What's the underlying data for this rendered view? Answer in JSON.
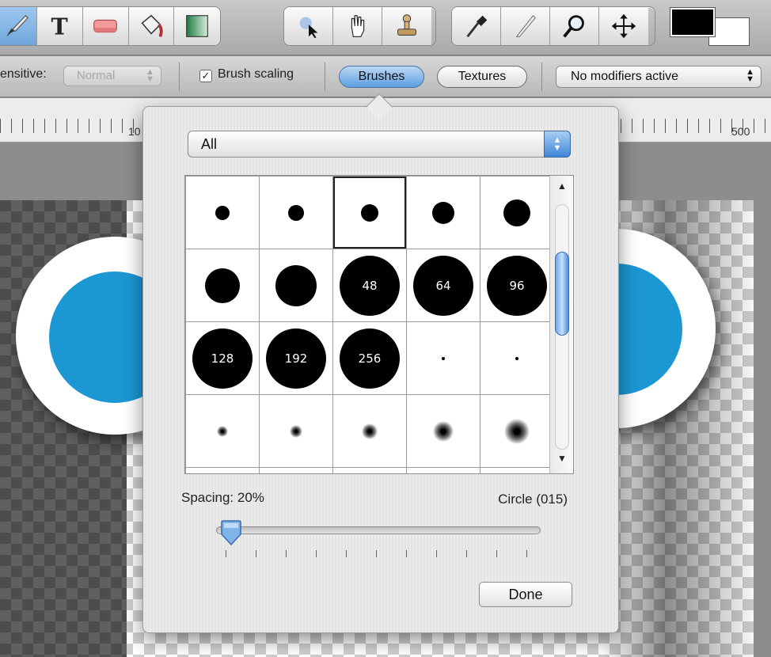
{
  "options_bar": {
    "mode_label": "ensitive:",
    "mode_value": "Normal",
    "brush_scaling_label": "Brush scaling",
    "brush_scaling_checked": true,
    "brushes_tab": "Brushes",
    "textures_tab": "Textures",
    "modifiers_value": "No modifiers active"
  },
  "ruler": {
    "labels": [
      "10",
      "500"
    ]
  },
  "brushes_panel": {
    "category": "All",
    "brushes": [
      {
        "size": 1,
        "label": ""
      },
      {
        "size": 2,
        "label": ""
      },
      {
        "size": 3,
        "label": "",
        "selected": true
      },
      {
        "size": 4,
        "label": ""
      },
      {
        "size": 5,
        "label": ""
      },
      {
        "size": 6,
        "label": ""
      },
      {
        "size": 7,
        "label": ""
      },
      {
        "size": 8,
        "label": "48"
      },
      {
        "size": 8,
        "label": "64"
      },
      {
        "size": 8,
        "label": "96"
      },
      {
        "size": 8,
        "label": "128"
      },
      {
        "size": 8,
        "label": "192"
      },
      {
        "size": 8,
        "label": "256"
      },
      {
        "size": 0,
        "label": ""
      },
      {
        "size": 0,
        "label": ""
      },
      {
        "size": 0,
        "label": "",
        "soft": true
      },
      {
        "size": 0,
        "label": "",
        "soft": true
      },
      {
        "size": 0,
        "label": "",
        "soft": true
      },
      {
        "size": 0,
        "label": "",
        "soft": true
      },
      {
        "size": 0,
        "label": "",
        "soft": true
      },
      {
        "size": 0,
        "label": ""
      },
      {
        "size": 0,
        "label": ""
      },
      {
        "size": 0,
        "label": ""
      },
      {
        "size": 0,
        "label": ""
      },
      {
        "size": 0,
        "label": ""
      }
    ],
    "spacing_label": "Spacing: 20%",
    "spacing_value": 0.2,
    "brush_name": "Circle (015)",
    "done_label": "Done"
  },
  "colors": {
    "foreground": "#000000",
    "background": "#ffffff",
    "accent": "#1b97d3"
  }
}
